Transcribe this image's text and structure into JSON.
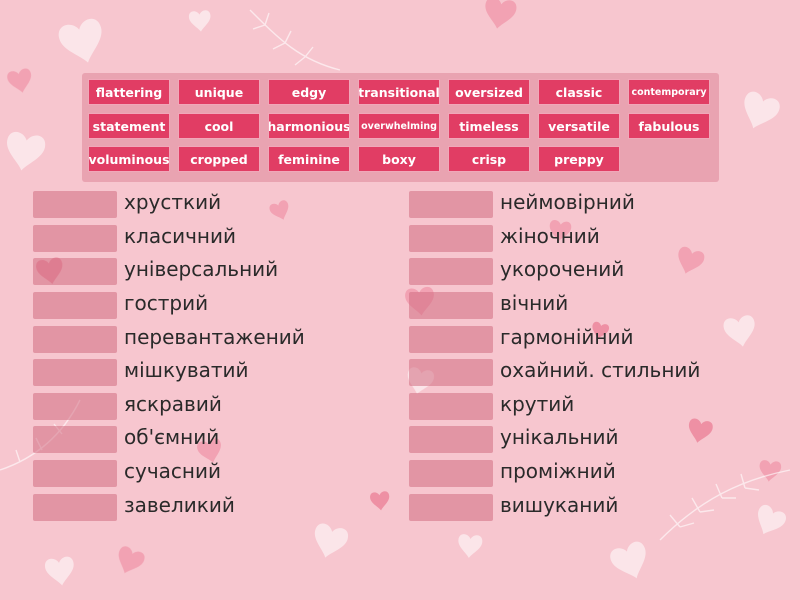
{
  "theme": {
    "background": "#f7c6cf",
    "tile_color": "#e13d64",
    "slot_color": "#d26e82",
    "text_color": "#2a2a2a"
  },
  "word_bank": [
    "flattering",
    "unique",
    "edgy",
    "transitional",
    "oversized",
    "classic",
    "contemporary",
    "statement",
    "cool",
    "harmonious",
    "overwhelming",
    "timeless",
    "versatile",
    "fabulous",
    "voluminous",
    "cropped",
    "feminine",
    "boxy",
    "crisp",
    "preppy"
  ],
  "left_column": [
    "хрусткий",
    "класичний",
    "універсальний",
    "гострий",
    "перевантажений",
    "мішкуватий",
    "яскравий",
    "об'ємний",
    "сучасний",
    "завеликий"
  ],
  "right_column": [
    "неймовірний",
    "жіночний",
    "укорочений",
    "вічний",
    "гармонійний",
    "охайний. стильний",
    "крутий",
    "унікальний",
    "проміжний",
    "вишуканий"
  ]
}
